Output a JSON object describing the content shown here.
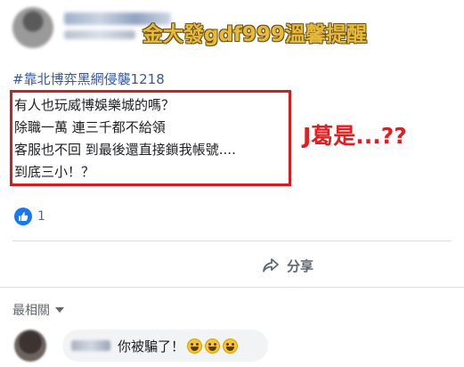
{
  "header": {
    "watermark": "金大發gdf999溫馨提醒"
  },
  "post": {
    "hashtag": "#靠北博弈黑網侵襲1218",
    "lines": [
      "有人也玩威博娛樂城的嗎？",
      "除職一萬 連三千都不給領",
      "客服也不回 到最後還直接鎖我帳號....",
      "到底三小！？"
    ],
    "annotation": "J葛是...??",
    "highlight_color": "#d81b1b"
  },
  "reactions": {
    "icon": "like-icon",
    "count": "1"
  },
  "actions": {
    "share_label": "分享",
    "share_icon": "share-arrow-icon"
  },
  "comments": {
    "sort_label": "最相關",
    "items": [
      {
        "text": "你被騙了！",
        "emoji_count": 3,
        "emoji": "grinning-face-icon"
      }
    ]
  },
  "colors": {
    "link": "#385898",
    "like_blue": "#1877f2",
    "watermark_gold": "#e8b93a",
    "annotation_red": "#e02020"
  }
}
